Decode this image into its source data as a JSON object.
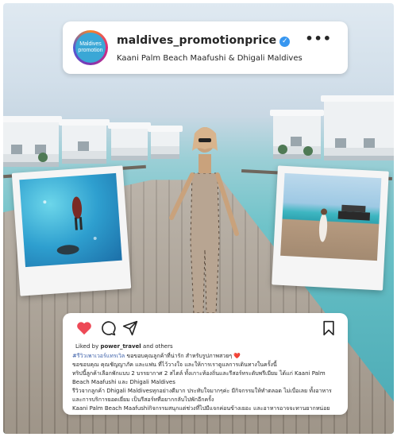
{
  "header": {
    "avatar_text": "Maldives promotion",
    "username": "maldives_promotionprice",
    "location": "Kaani Palm Beach Maafushi & Dhigali Maldives"
  },
  "post": {
    "liked_prefix": "Liked by",
    "liked_user": "power_travel",
    "liked_suffix": "and others",
    "hashtag": "#รีวิวเพาเวอร์แทรเวิล",
    "line1": " ขอขอบคุณลูกค้าที่น่ารัก สำหรับรูปภาพสวยๆ ❤️",
    "line2": "ขอขอบคุณ คุณชัญญาภัค และแฟน ที่ไว้วางใจ และให้การเราดูแลการเดินทางในครั้งนี้",
    "line3": "ทริปนี้ลูกค้าเลือกพักแบบ 2 บรรยากาศ 2 สไตล์ ทั้งเกาะท้องถิ่นและรีสอร์ทระดับพรีเมียม ได้แก่ Kaani Palm Beach Maafushi และ Dhigali Maldives",
    "line4": "รีวิวจากลูกค้า Dhigali Maldivesทุกอย่างดีมาก ประทับใจมากๆค่ะ มีกิจกรรมให้ทำตลอด ไม่เบื่อเลย ทั้งอาหารและการบริการยอดเยี่ยม เป็นรีสอร์ทที่อยากกลับไปพักอีกครั้ง",
    "line5": "Kaani Palm Beach Maafushiกิจกรรมสนุกแต่ช่วงที่ไปมีแจกค่อนข้างเยอะ และอาหารอาจจะทานยากหน่อย"
  },
  "icons": {
    "like": "heart-icon",
    "comment": "comment-icon",
    "share": "send-icon",
    "save": "bookmark-icon",
    "more": "more-icon",
    "verified": "verified-icon"
  },
  "colors": {
    "like": "#ed4956",
    "verified": "#3897f0",
    "hashtag": "#3b5fa8"
  }
}
